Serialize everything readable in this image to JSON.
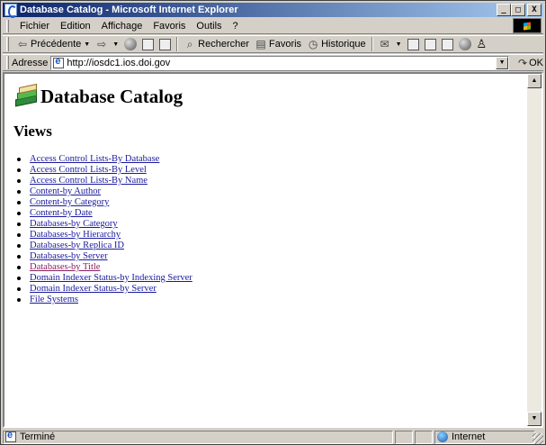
{
  "window": {
    "title": "Database Catalog - Microsoft Internet Explorer",
    "minimize": "_",
    "maximize": "□",
    "close": "X"
  },
  "menu": {
    "items": [
      {
        "label": "Fichier"
      },
      {
        "label": "Edition"
      },
      {
        "label": "Affichage"
      },
      {
        "label": "Favoris"
      },
      {
        "label": "Outils"
      },
      {
        "label": "?"
      }
    ]
  },
  "toolbar": {
    "back_label": "Précédente",
    "search_label": "Rechercher",
    "favorites_label": "Favoris",
    "history_label": "Historique"
  },
  "address": {
    "label": "Adresse",
    "url": "http://iosdc1.ios.doi.gov",
    "go_label": "OK"
  },
  "page": {
    "title": "Database Catalog",
    "views_heading": "Views",
    "views": [
      {
        "label": "Access Control Lists-By Database",
        "visited": false
      },
      {
        "label": "Access Control Lists-By Level",
        "visited": false
      },
      {
        "label": "Access Control Lists-By Name",
        "visited": false
      },
      {
        "label": "Content-by Author",
        "visited": false
      },
      {
        "label": "Content-by Category",
        "visited": false
      },
      {
        "label": "Content-by Date",
        "visited": false
      },
      {
        "label": "Databases-by Category",
        "visited": false
      },
      {
        "label": "Databases-by Hierarchy",
        "visited": false
      },
      {
        "label": "Databases-by Replica ID",
        "visited": false
      },
      {
        "label": "Databases-by Server",
        "visited": false
      },
      {
        "label": "Databases-by Title",
        "visited": true
      },
      {
        "label": "Domain Indexer Status-by Indexing Server",
        "visited": false
      },
      {
        "label": "Domain Indexer Status-by Server",
        "visited": false
      },
      {
        "label": "File Systems",
        "visited": false
      }
    ]
  },
  "status": {
    "text": "Terminé",
    "zone": "Internet"
  },
  "colors": {
    "link": "#1a1a9e",
    "visited_link": "#8a1f5e",
    "title_bar_start": "#0a246a",
    "title_bar_end": "#a6caf0"
  }
}
